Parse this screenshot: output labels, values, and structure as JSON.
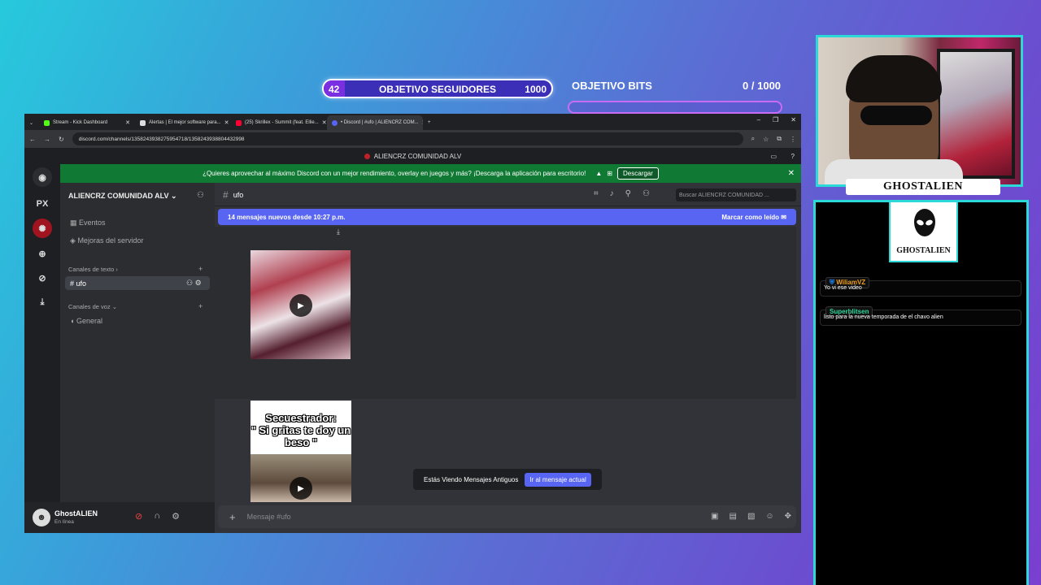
{
  "overlay": {
    "follower_goal": {
      "current": "42",
      "label": "OBJETIVO SEGUIDORES",
      "target": "1000",
      "progress": 0.042
    },
    "bits_goal": {
      "label": "OBJETIVO BITS",
      "current": "0",
      "separator": "/",
      "target": "1000"
    },
    "streamer_name": "GHOSTALIEN",
    "logo_text": "GHOSTALIEN"
  },
  "browser": {
    "tabs": [
      {
        "title": "Stream - Kick Dashboard",
        "color": "#53fc18"
      },
      {
        "title": "Alertas | El mejor software para...",
        "color": "#dddddd"
      },
      {
        "title": "(25) Skrillex - Summit (feat. Ellie...",
        "color": "#ff0033"
      },
      {
        "title": "• Discord | #ufo | ALIENCRZ COM...",
        "color": "#5865f2"
      }
    ],
    "url": "discord.com/channels/1358243938275954718/1358243938804432998"
  },
  "discord": {
    "window_title": "ALIENCRZ COMUNIDAD ALV",
    "banner_text": "¿Quieres aprovechar al máximo Discord con un mejor rendimiento, overlay en juegos y más? ¡Descarga la aplicación para escritorio!",
    "banner_button": "Descargar",
    "rail_label": "PX",
    "server_name": "ALIENCRZ COMUNIDAD ALV",
    "events": "Eventos",
    "boosts": "Mejoras del servidor",
    "text_category": "Canales de texto",
    "text_channel": "ufo",
    "voice_category": "Canales de voz",
    "voice_channel": "General",
    "channel_header": "ufo",
    "search_placeholder": "Buscar ALIENCRZ COMUNIDAD ...",
    "new_messages": "14 mensajes nuevos desde 10:27 p.m.",
    "mark_read": "Marcar como leído",
    "video_caption_1": "Secuestrador:",
    "video_caption_2": "\" Si gritas te doy un beso \"",
    "old_messages": "Estás Viendo Mensajes Antiguos",
    "jump_button": "Ir al mensaje actual",
    "user_name": "GhostALIEN",
    "user_status": "En línea",
    "composer_placeholder": "Mensaje #ufo"
  },
  "chat": [
    {
      "user": "WiliamVZ",
      "color": "#f0a020",
      "text": "Yo vi ese video"
    },
    {
      "user": "Superblitsen",
      "color": "#2bd9a0",
      "text": "listo para la nueva temporada de el chavo alien"
    }
  ]
}
